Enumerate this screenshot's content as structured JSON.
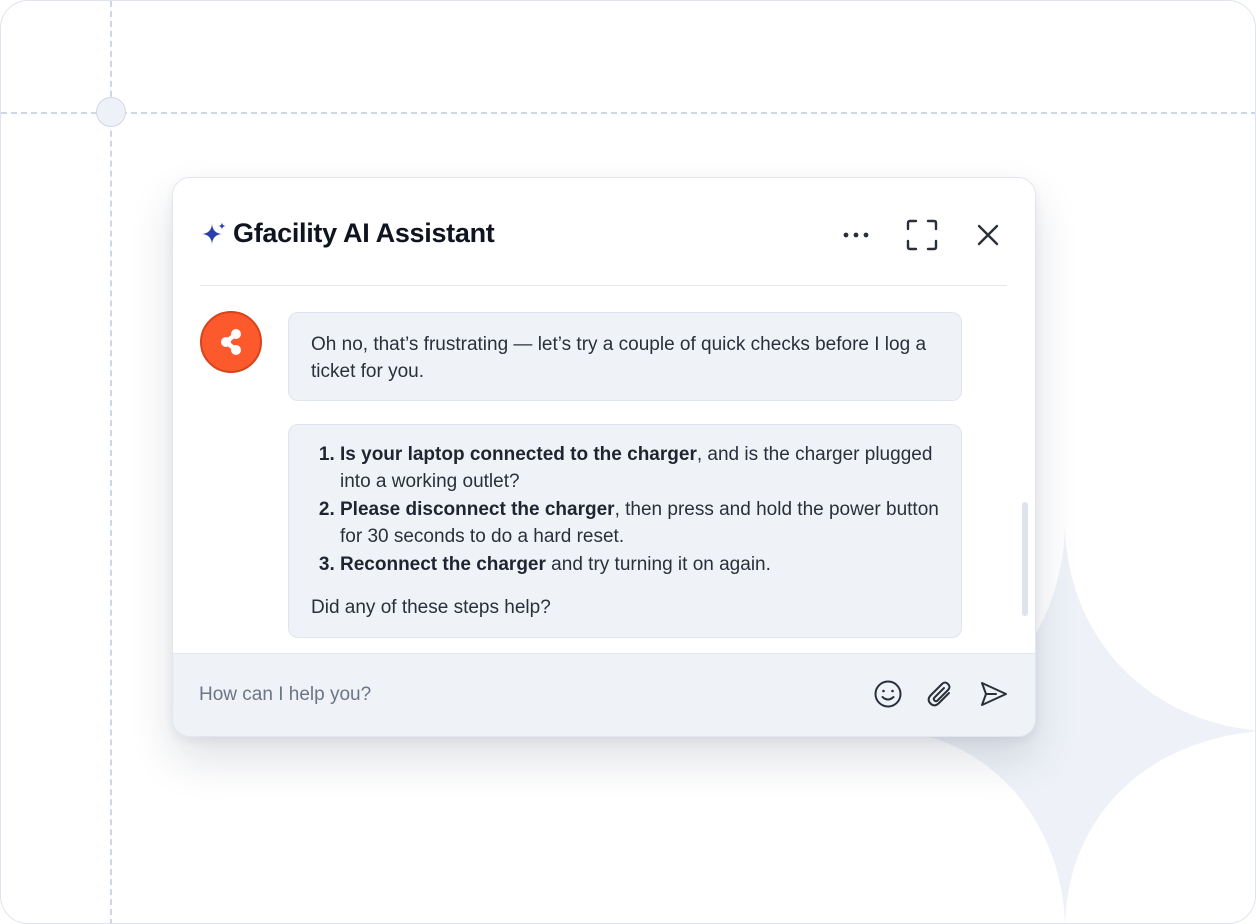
{
  "chat": {
    "title": "Gfacility AI Assistant",
    "header_actions": {
      "more": "more-horizontal-icon",
      "expand": "expand-icon",
      "close": "close-icon"
    },
    "messages": {
      "greeting": "Oh no, that’s frustrating — let’s try a couple of quick checks before I log a ticket for you.",
      "steps": [
        {
          "bold": "Is your laptop connected to the charger",
          "rest": ", and is the charger plugged into a working outlet?"
        },
        {
          "bold": "Please disconnect the charger",
          "rest": ", then press and hold the power button for 30 seconds to do a hard reset."
        },
        {
          "bold": "Reconnect the charger",
          "rest": " and try turning it on again."
        }
      ],
      "question": "Did any of these steps help?"
    },
    "composer": {
      "placeholder": "How can I help you?",
      "emoji": "smiley-icon",
      "attach": "paperclip-icon",
      "send": "send-icon"
    }
  },
  "colors": {
    "accent_star": "#2b3fa8",
    "avatar": "#fc5a2d",
    "bubble_bg": "#eff3f8"
  }
}
